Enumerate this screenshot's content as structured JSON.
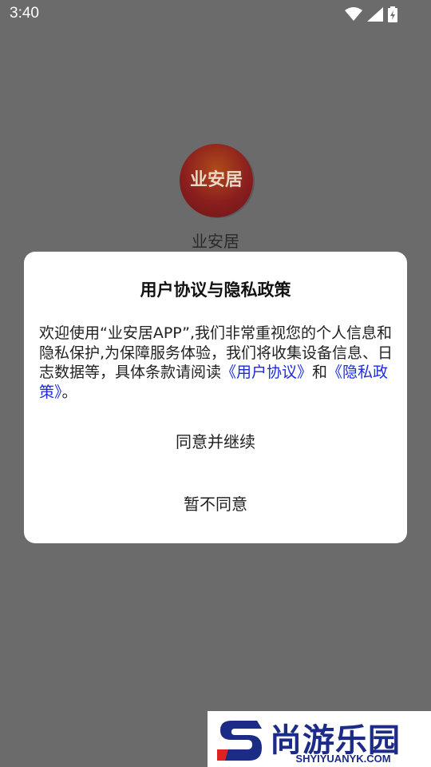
{
  "status_bar": {
    "time": "3:40",
    "icons": [
      "wifi-icon",
      "signal-icon",
      "battery-charging-icon"
    ]
  },
  "splash": {
    "logo_text": "业安居",
    "app_name": "业安居"
  },
  "dialog": {
    "title": "用户协议与隐私政策",
    "body_text": "欢迎使用“业安居APP”,我们非常重视您的个人信息和隐私保护,为保障服务体验，我们将收集设备信息、日志数据等，具体条款请阅读",
    "user_agreement_link": "《用户协议》",
    "conjunction": "和",
    "privacy_policy_link": "《隐私政策》",
    "period": "。",
    "agree_button": "同意并继续",
    "decline_button": "暂不同意"
  },
  "watermark": {
    "title": "尚游乐园",
    "domain": "SHYIYUANYK.COM"
  },
  "colors": {
    "overlay": "#6b6b6b",
    "link": "#1a2be0",
    "watermark": "#1b2b86"
  }
}
